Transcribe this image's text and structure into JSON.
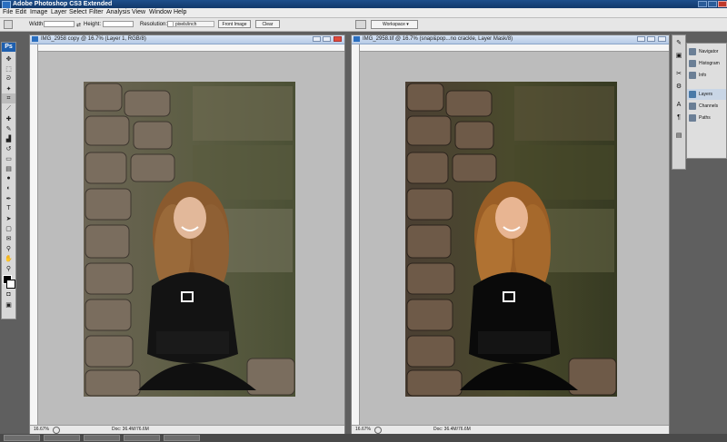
{
  "app": {
    "title": "Adobe Photoshop CS3 Extended"
  },
  "menu": [
    "File",
    "Edit",
    "Image",
    "Layer",
    "Select",
    "Filter",
    "Analysis",
    "View",
    "Window",
    "Help"
  ],
  "options_bar": {
    "width_label": "Width:",
    "height_label": "Height:",
    "resolution_label": "Resolution:",
    "resolution_unit": "pixels/inch",
    "front_image_button": "Front Image",
    "clear_button": "Clear",
    "workspace_label": "Workspace ▾"
  },
  "toolbox": {
    "logo": "Ps",
    "tools": [
      "move-icon",
      "marquee-icon",
      "lasso-icon",
      "magic-wand-icon",
      "crop-icon",
      "slice-icon",
      "healing-icon",
      "brush-icon",
      "stamp-icon",
      "history-brush-icon",
      "eraser-icon",
      "gradient-icon",
      "blur-icon",
      "dodge-icon",
      "pen-icon",
      "type-icon",
      "path-select-icon",
      "shape-icon",
      "notes-icon",
      "eyedropper-icon",
      "hand-icon",
      "zoom-icon"
    ]
  },
  "documents": [
    {
      "title": "IMG_2958 copy @ 16.7% (Layer 1, RGB/8)",
      "zoom": "16.67%",
      "doc_size": "Doc: 36.4M/76.6M",
      "variant": "muted"
    },
    {
      "title": "IMG_2958.tif @ 16.7% (snap&pop...no crackle, Layer Mask/8)",
      "zoom": "16.67%",
      "doc_size": "Doc: 36.4M/76.6M",
      "variant": "punchy"
    }
  ],
  "panels": [
    {
      "label": "Navigator",
      "icon": "navigator-icon"
    },
    {
      "label": "Histogram",
      "icon": "histogram-icon"
    },
    {
      "label": "Info",
      "icon": "info-icon"
    },
    {
      "label": "Layers",
      "icon": "layers-icon"
    },
    {
      "label": "Channels",
      "icon": "channels-icon"
    },
    {
      "label": "Paths",
      "icon": "paths-icon"
    }
  ],
  "colors": {
    "workspace_bg": "#5f5f5f",
    "titlebar": "#1e4f8c",
    "canvas_gray": "#bcbcbc"
  }
}
